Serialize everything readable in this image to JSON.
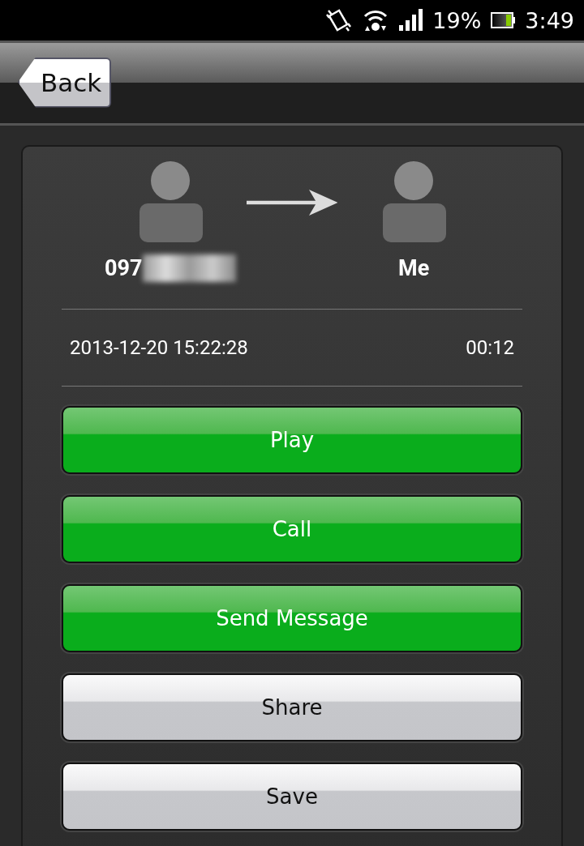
{
  "status_bar": {
    "battery": "19%",
    "time": "3:49"
  },
  "header": {
    "back_button": "Back"
  },
  "call": {
    "from": "097",
    "to": "Me",
    "date": "2013-12-20 15:22:28",
    "duration": "00:12"
  },
  "buttons": [
    {
      "label": "Play",
      "kind": "green"
    },
    {
      "label": "Call",
      "kind": "green"
    },
    {
      "label": "Send Message",
      "kind": "green"
    },
    {
      "label": "Share",
      "kind": "grey"
    },
    {
      "label": "Save",
      "kind": "grey"
    }
  ]
}
